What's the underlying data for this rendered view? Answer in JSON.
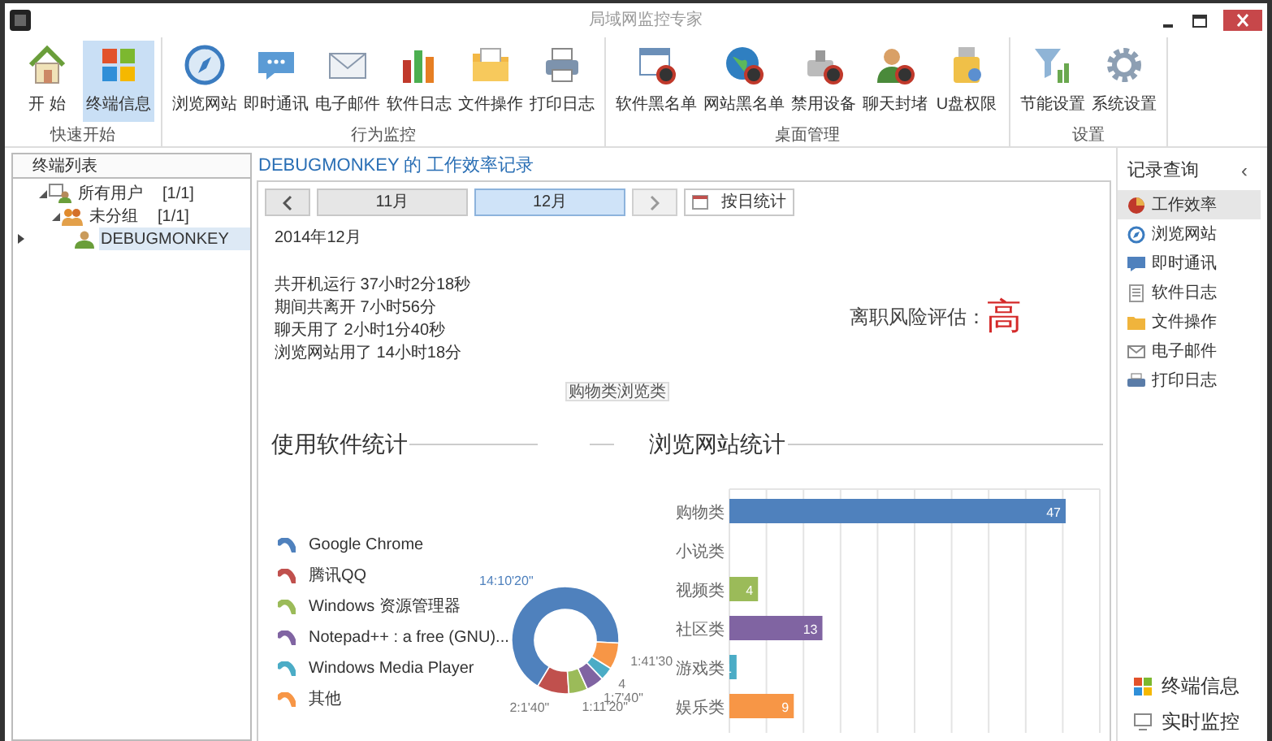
{
  "window": {
    "title": "局域网监控专家"
  },
  "ribbon": {
    "groups": [
      {
        "label": "快速开始",
        "items": [
          {
            "label": "开 始",
            "selected": false
          },
          {
            "label": "终端信息",
            "selected": true
          }
        ]
      },
      {
        "label": "行为监控",
        "items": [
          {
            "label": "浏览网站",
            "selected": false
          },
          {
            "label": "即时通讯",
            "selected": false
          },
          {
            "label": "电子邮件",
            "selected": false
          },
          {
            "label": "软件日志",
            "selected": false
          },
          {
            "label": "文件操作",
            "selected": false
          },
          {
            "label": "打印日志",
            "selected": false
          }
        ]
      },
      {
        "label": "桌面管理",
        "items": [
          {
            "label": "软件黑名单",
            "selected": false
          },
          {
            "label": "网站黑名单",
            "selected": false
          },
          {
            "label": "禁用设备",
            "selected": false
          },
          {
            "label": "聊天封堵",
            "selected": false
          },
          {
            "label": "U盘权限",
            "selected": false
          }
        ]
      },
      {
        "label": "设置",
        "items": [
          {
            "label": "节能设置",
            "selected": false
          },
          {
            "label": "系统设置",
            "selected": false
          }
        ]
      }
    ]
  },
  "terminal_tree": {
    "header": "终端列表",
    "nodes": [
      {
        "label": "所有用户",
        "count": "[1/1]",
        "expanded": true,
        "selected": false,
        "children": [
          {
            "label": "未分组",
            "count": "[1/1]",
            "expanded": true,
            "selected": false,
            "children": [
              {
                "label": "DEBUGMONKEY",
                "selected": true
              }
            ]
          }
        ]
      }
    ]
  },
  "main": {
    "title": "DEBUGMONKEY 的 工作效率记录",
    "months": [
      {
        "label": "11月",
        "selected": false
      },
      {
        "label": "12月",
        "selected": true
      }
    ],
    "daily_button": "按日统计",
    "period": "2014年12月",
    "summary": [
      "共开机运行 37小时2分18秒",
      "期间共离开 7小时56分",
      "聊天用了 2小时1分40秒",
      "浏览网站用了 14小时18分"
    ],
    "risk": {
      "label": "离职风险评估：",
      "value": "高"
    },
    "hover_label": "购物类浏览类",
    "software_stats": {
      "title": "使用软件统计",
      "legend": [
        {
          "color": "#4f81bd"
        },
        {
          "color": "#c0504d"
        },
        {
          "color": "#9bbb59"
        },
        {
          "color": "#8064a2"
        },
        {
          "color": "#4bacc6"
        },
        {
          "color": "#f79646"
        }
      ],
      "chart_data": {
        "type": "donut",
        "categories": [
          "Google Chrome",
          "腾讯QQ",
          "Windows 资源管理器",
          "Notepad++ : a free (GNU)...",
          "Windows Media Player",
          "其他"
        ],
        "values": [
          67.2,
          9.7,
          5.7,
          5.4,
          4,
          8.0
        ],
        "value_labels": [
          "14:10'20\"",
          "2:1'40\"",
          "1:11'20\"",
          "1:7'40\"",
          "4",
          "1:41'30"
        ]
      }
    },
    "website_stats": {
      "title": "浏览网站统计",
      "chart_data": {
        "type": "bar",
        "orientation": "horizontal",
        "categories": [
          "购物类",
          "小说类",
          "视频类",
          "社区类",
          "游戏类",
          "娱乐类"
        ],
        "series": [
          {
            "values": [
              47,
              null,
              4,
              13,
              1,
              9
            ]
          }
        ],
        "data_labels": true
      }
    }
  },
  "right_panel": {
    "title": "记录查询",
    "collapse": "‹",
    "items": [
      {
        "label": "工作效率",
        "selected": true
      },
      {
        "label": "浏览网站",
        "selected": false
      },
      {
        "label": "即时通讯",
        "selected": false
      },
      {
        "label": "软件日志",
        "selected": false
      },
      {
        "label": "文件操作",
        "selected": false
      },
      {
        "label": "电子邮件",
        "selected": false
      },
      {
        "label": "打印日志",
        "selected": false
      }
    ],
    "bottom_items": [
      {
        "label": "终端信息"
      },
      {
        "label": "实时监控"
      }
    ]
  }
}
